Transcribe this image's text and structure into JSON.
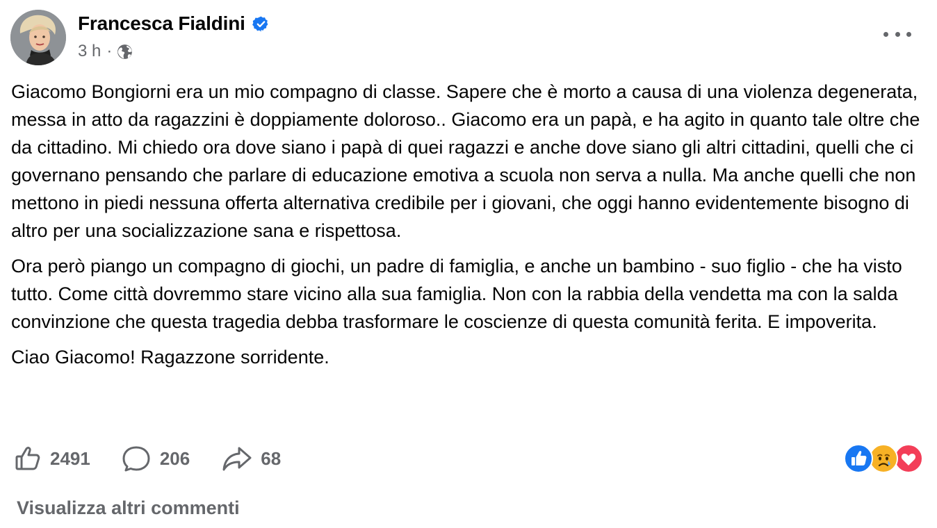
{
  "post": {
    "author": "Francesca Fialdini",
    "verified_icon": "verified-badge-icon",
    "time": "3 h",
    "separator": "·",
    "audience_icon": "globe-icon",
    "more_icon": "more-options-icon",
    "paragraphs": [
      "Giacomo Bongiorni era un mio compagno di classe. Sapere che è morto a causa di una violenza degenerata, messa in atto da ragazzini è doppiamente doloroso.. Giacomo era un papà, e ha agito in quanto tale oltre che da cittadino. Mi chiedo ora dove siano i papà di quei ragazzi e anche dove siano gli altri cittadini, quelli che ci governano pensando che parlare di educazione emotiva a scuola non serva a nulla. Ma anche quelli che non mettono in piedi nessuna offerta alternativa credibile per i giovani, che oggi hanno evidentemente bisogno di altro per una socializzazione sana e rispettosa.",
      "Ora però piango un compagno di giochi, un padre di famiglia, e anche un bambino - suo figlio - che ha visto tutto. Come città dovremmo stare vicino alla sua famiglia. Non con la rabbia della vendetta ma con la salda convinzione che questa tragedia debba trasformare le coscienze di questa comunità ferita. E impoverita.",
      "Ciao Giacomo! Ragazzone sorridente."
    ],
    "actions": {
      "likes": "2491",
      "comments": "206",
      "shares": "68"
    },
    "reactions": [
      "like",
      "sad",
      "love"
    ],
    "colors": {
      "verified": "#1877f2",
      "like": "#1877f2",
      "sad": "#f7b125",
      "love": "#f33e58",
      "secondary_text": "#65676b"
    },
    "view_more_comments": "Visualizza altri commenti"
  }
}
